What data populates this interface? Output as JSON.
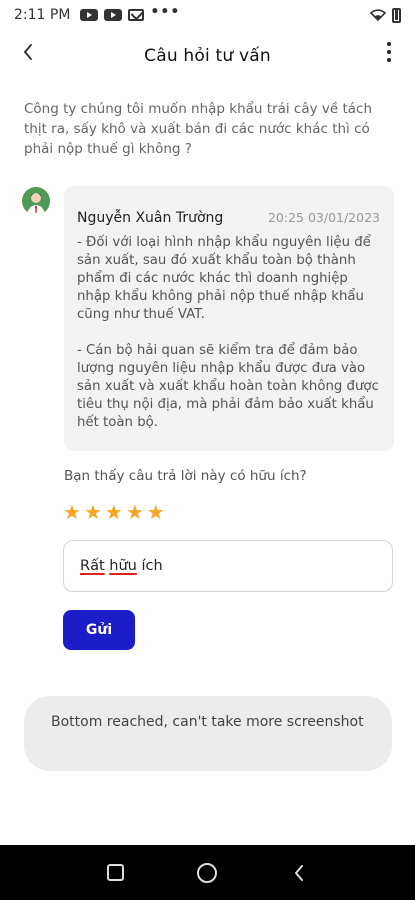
{
  "status_bar": {
    "time": "2:11 PM",
    "dots": "•••",
    "icons": [
      "youtube-icon",
      "youtube-icon",
      "gmail-icon",
      "wifi-icon",
      "battery-icon"
    ]
  },
  "header": {
    "title": "Câu hỏi tư vấn"
  },
  "question": {
    "text": "Công ty chúng tôi muốn nhập khẩu trái cây về tách thịt ra, sấy khô và xuất bán đi các nước khác thì có phải nộp thuế gì không ?"
  },
  "answer": {
    "author": "Nguyễn Xuân Trường",
    "time": "20:25 03/01/2023",
    "paragraph1": "- Đối với loại hình nhập khẩu nguyên liệu để sản xuất, sau đó xuất khẩu toàn bộ thành phẩm đi các nước khác thì doanh nghiệp nhập khẩu không phải nộp thuế nhập khẩu cũng như thuế VAT.",
    "paragraph2": "- Cán bộ hải quan sẽ kiểm tra để đảm bảo lượng nguyên liệu nhập khẩu được đưa vào sản xuất và xuất khẩu hoàn toàn không được tiêu thụ nội địa, mà phải đảm bảo xuất khẩu hết toàn bộ."
  },
  "feedback": {
    "question": "Bạn thấy câu trả lời này có hữu ích?",
    "rating": 5,
    "rating_max": 5,
    "star_color": "#f6a623",
    "input_value_word1": "Rất",
    "input_value_word2": "hữu",
    "input_value_word3": "ích",
    "send_label": "Gửi",
    "send_color": "#1c1cc8"
  },
  "toast": {
    "text": "Bottom reached, can't take more screenshot"
  }
}
